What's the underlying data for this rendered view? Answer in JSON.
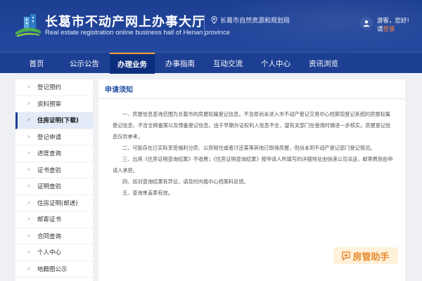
{
  "header": {
    "title_cn": "长葛市不动产网上办事大厅",
    "title_en": "Real estate registration online business hall of Henan province",
    "location": "长葛市自然资源和规划局",
    "user_greeting": "游客，您好!",
    "user_login_prefix": "请",
    "user_login_link": "登录",
    "colors": {
      "header_bg": "#1d3f93",
      "active_tab": "#0c2e7c",
      "accent": "#f2a52b"
    }
  },
  "nav": {
    "items": [
      {
        "label": "首页"
      },
      {
        "label": "公示公告"
      },
      {
        "label": "办理业务"
      },
      {
        "label": "办事指南"
      },
      {
        "label": "互动交流"
      },
      {
        "label": "个人中心"
      },
      {
        "label": "资讯浏览"
      }
    ],
    "active": "办理业务"
  },
  "sidebar": {
    "items": [
      {
        "label": "登记预约"
      },
      {
        "label": "资料预审"
      },
      {
        "label": "住房证明(下载)"
      },
      {
        "label": "登记申请"
      },
      {
        "label": "进度查询"
      },
      {
        "label": "证书查验"
      },
      {
        "label": "证明查验"
      },
      {
        "label": "住房证明(邮递)"
      },
      {
        "label": "邮寄证书"
      },
      {
        "label": "合同查询"
      },
      {
        "label": "个人中心"
      },
      {
        "label": "地籍图公示"
      }
    ],
    "active": "住房证明(下载)"
  },
  "content": {
    "title": "申请须知",
    "paragraphs": [
      "一、房屋信息查询范围为长葛市的房屋权属登记信息。不含原尚未进入市不动产登记交易中心档案馆登记系统的房屋权属登记信息，不含全网备案以及预备登记信息。由于早期办证权利人信息不全，望有关部门在使用时做进一步核实。房屋登记信息仅供参考。",
      "二、可能存在已实际享受福利分房、公房租住或者讨还某等其他已取得房屋，但尚未到不动产登记部门登记情况。",
      "三、出具《住房证明查询结果》不收费；《住房证明查询结果》按申请人所填写的详细地址由快递公司派送，邮寄费用由申请人承担。",
      "四、如对查询结果有异议，请及时向我中心档案科反馈。",
      "五、查询单盖章有效。"
    ]
  },
  "watermark": {
    "text": "房管助手"
  }
}
